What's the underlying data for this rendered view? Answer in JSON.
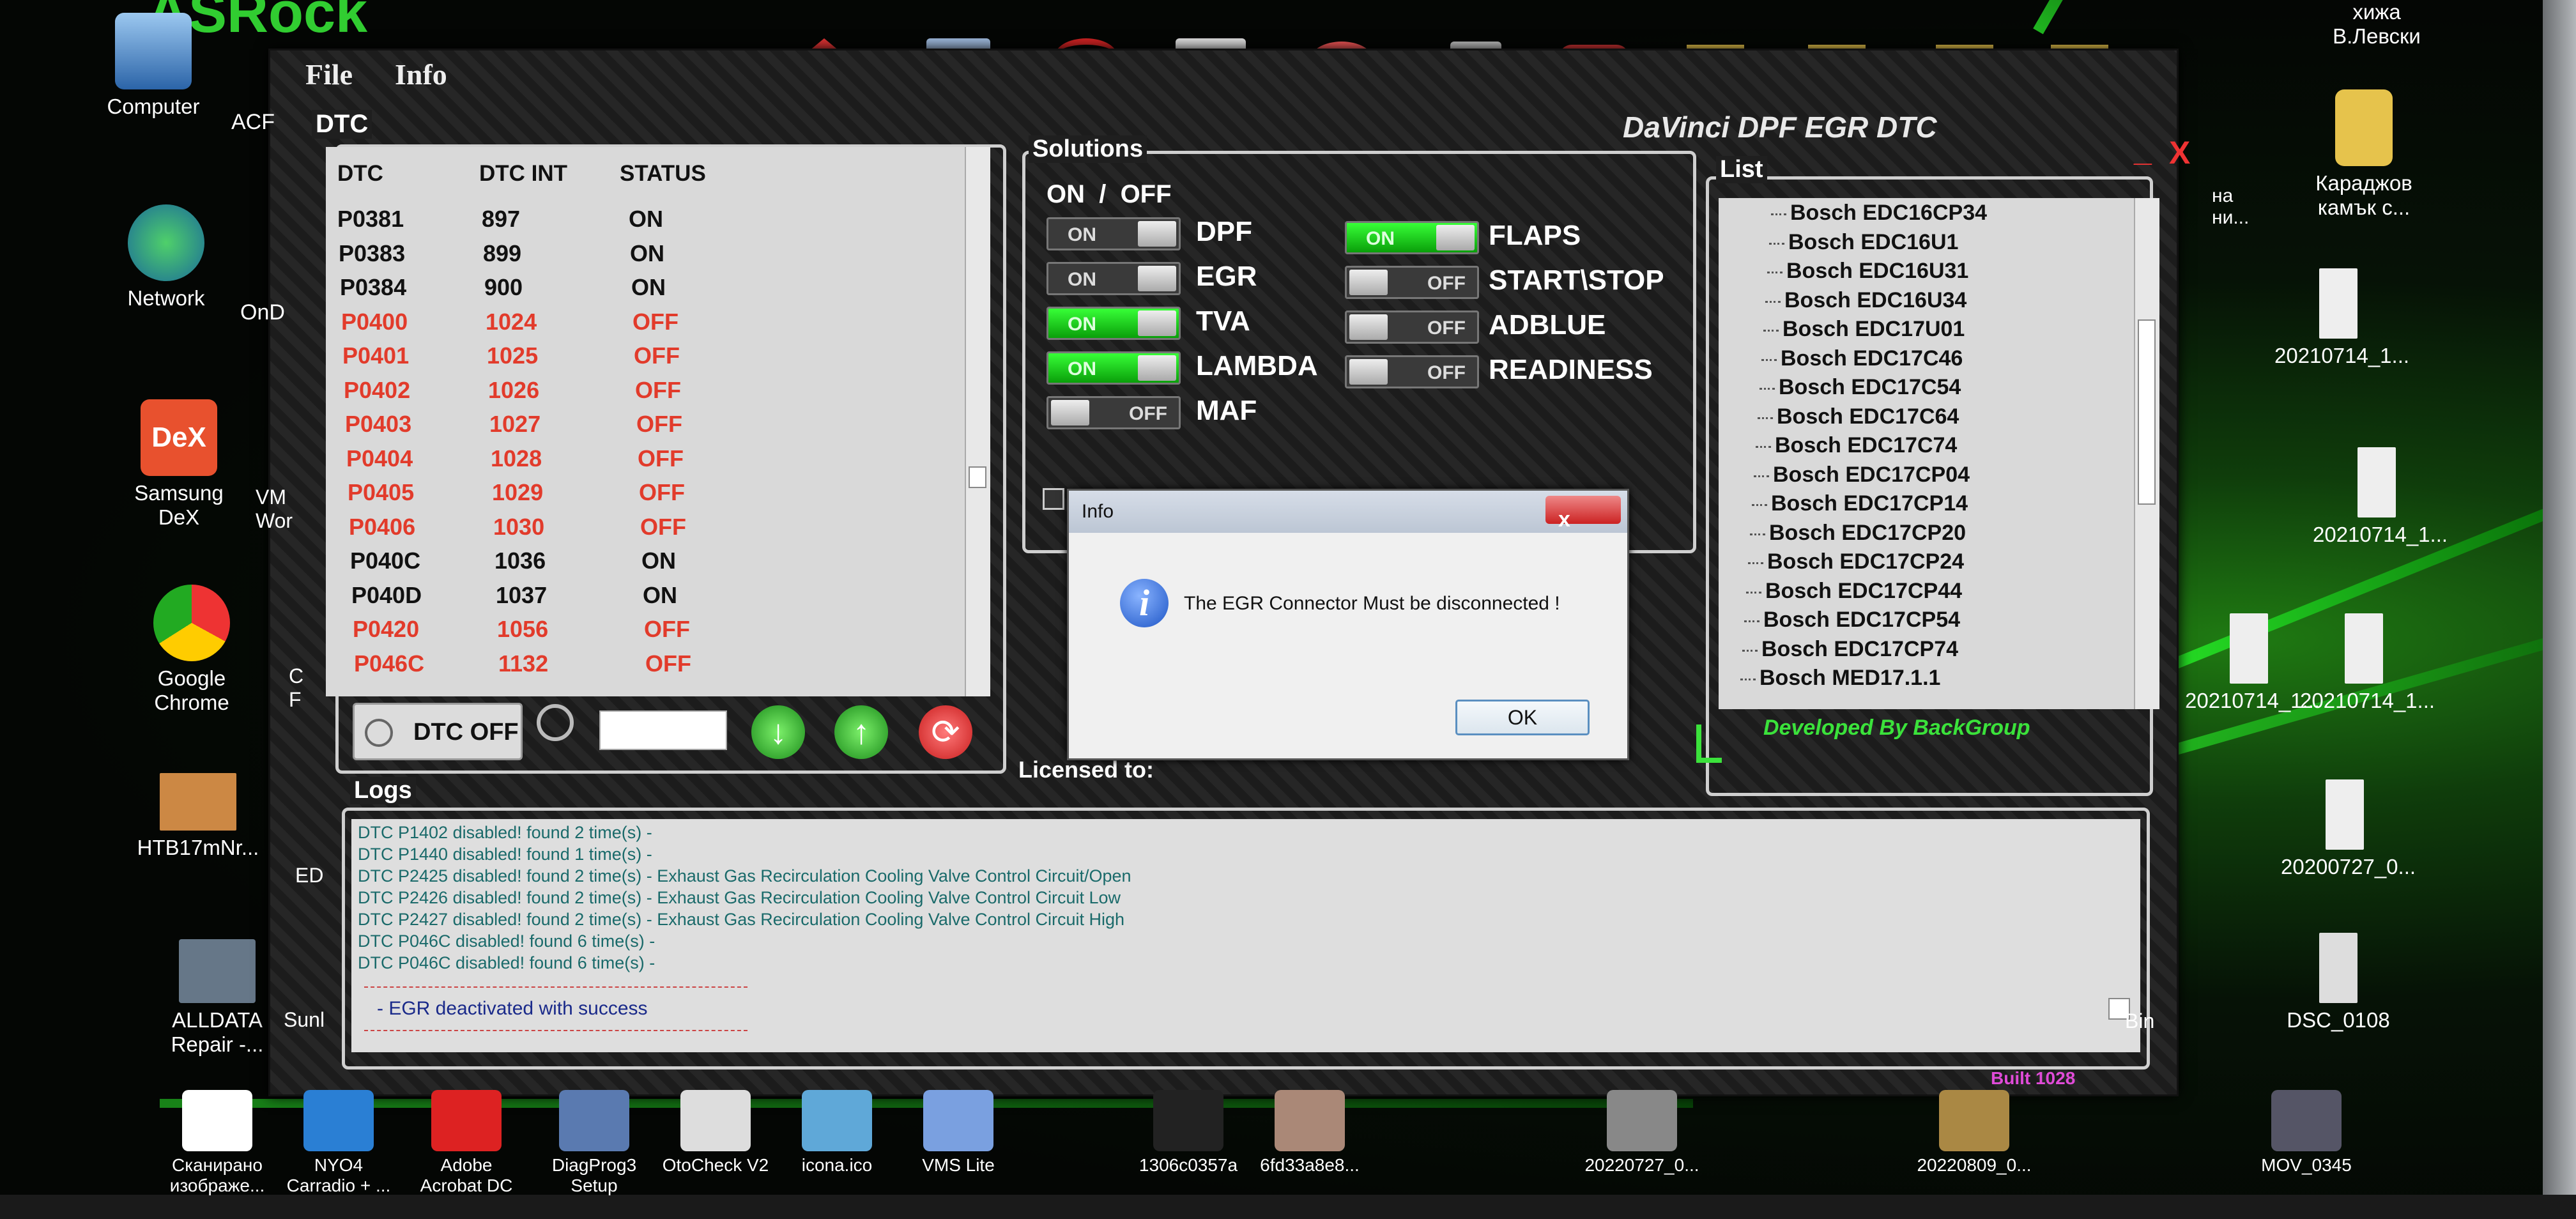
{
  "desktop_left": [
    {
      "label": "Computer",
      "icon": "computer-icon"
    },
    {
      "label": "Network",
      "icon": "network-icon"
    },
    {
      "label": "Samsung DeX",
      "icon": "dex-icon"
    },
    {
      "label": "Google Chrome",
      "icon": "chrome-icon"
    },
    {
      "label": "HTB17mNr...",
      "icon": "image-file-icon"
    },
    {
      "label": "ALLDATA Repair -...",
      "icon": "alldata-icon"
    }
  ],
  "desktop_left_partial": [
    "ACF",
    "OnD",
    "VM Wor",
    "C F",
    "ED",
    "Sunl"
  ],
  "desktop_right": [
    {
      "label": "хижа В.Левски"
    },
    {
      "label": "Караджов камък с..."
    },
    {
      "label": "20210714_1..."
    },
    {
      "label": "20210714_1..."
    },
    {
      "label": "20210714_1..."
    },
    {
      "label": "20210714_1..."
    },
    {
      "label": "20200727_0..."
    },
    {
      "label": "DSC_0108"
    }
  ],
  "desktop_right_partial": [
    "на ни...",
    "Bin"
  ],
  "taskbar": [
    {
      "label": "Сканирано изображе...",
      "icon": "pdf-icon"
    },
    {
      "label": "NYO4 Carradio + ...",
      "icon": "n4-icon"
    },
    {
      "label": "Adobe Acrobat DC",
      "icon": "acrobat-icon"
    },
    {
      "label": "DiagProg3 Setup",
      "icon": "installer-icon"
    },
    {
      "label": "OtoCheck V2",
      "icon": "otocheck-icon"
    },
    {
      "label": "icona.ico",
      "icon": "ico-file-icon"
    },
    {
      "label": "VMS Lite",
      "icon": "vms-icon"
    },
    {
      "label": "1306c0357a",
      "icon": "chip-image-icon"
    },
    {
      "label": "6fd33a8e8...",
      "icon": "photo-icon"
    },
    {
      "label": "20220727_0...",
      "icon": "photo-icon"
    },
    {
      "label": "20220809_0...",
      "icon": "photo-icon"
    },
    {
      "label": "MOV_0345",
      "icon": "video-icon"
    }
  ],
  "app": {
    "menu": {
      "file": "File",
      "info": "Info"
    },
    "title": "DaVinci DPF EGR DTC",
    "dtc": {
      "legend": "DTC",
      "headers": [
        "DTC",
        "DTC INT",
        "STATUS"
      ],
      "rows": [
        {
          "code": "P0381",
          "int": "897",
          "status": "ON"
        },
        {
          "code": "P0383",
          "int": "899",
          "status": "ON"
        },
        {
          "code": "P0384",
          "int": "900",
          "status": "ON"
        },
        {
          "code": "P0400",
          "int": "1024",
          "status": "OFF"
        },
        {
          "code": "P0401",
          "int": "1025",
          "status": "OFF"
        },
        {
          "code": "P0402",
          "int": "1026",
          "status": "OFF"
        },
        {
          "code": "P0403",
          "int": "1027",
          "status": "OFF"
        },
        {
          "code": "P0404",
          "int": "1028",
          "status": "OFF"
        },
        {
          "code": "P0405",
          "int": "1029",
          "status": "OFF"
        },
        {
          "code": "P0406",
          "int": "1030",
          "status": "OFF"
        },
        {
          "code": "P040C",
          "int": "1036",
          "status": "ON"
        },
        {
          "code": "P040D",
          "int": "1037",
          "status": "ON"
        },
        {
          "code": "P0420",
          "int": "1056",
          "status": "OFF"
        },
        {
          "code": "P046C",
          "int": "1132",
          "status": "OFF"
        }
      ],
      "dtc_off_button": "DTC OFF",
      "search_value": ""
    },
    "solutions": {
      "legend": "Solutions",
      "on_off_header": "ON  /  OFF",
      "left": [
        {
          "name": "DPF",
          "state": "ON"
        },
        {
          "name": "EGR",
          "state": "ON"
        },
        {
          "name": "TVA",
          "state": "ON"
        },
        {
          "name": "LAMBDA",
          "state": "ON"
        },
        {
          "name": "MAF",
          "state": "OFF"
        }
      ],
      "right": [
        {
          "name": "FLAPS",
          "state": "ON"
        },
        {
          "name": "START\\STOP",
          "state": "OFF"
        },
        {
          "name": "ADBLUE",
          "state": "OFF"
        },
        {
          "name": "READINESS",
          "state": "OFF"
        }
      ],
      "licensed_to": "Licensed to:"
    },
    "list": {
      "legend": "List",
      "items": [
        "Bosch EDC16CP34",
        "Bosch EDC16U1",
        "Bosch EDC16U31",
        "Bosch EDC16U34",
        "Bosch EDC17U01",
        "Bosch EDC17C46",
        "Bosch EDC17C54",
        "Bosch EDC17C64",
        "Bosch EDC17C74",
        "Bosch EDC17CP04",
        "Bosch EDC17CP14",
        "Bosch EDC17CP20",
        "Bosch EDC17CP24",
        "Bosch EDC17CP44",
        "Bosch EDC17CP54",
        "Bosch EDC17CP74",
        "Bosch MED17.1.1"
      ],
      "developed_by": "Developed By BackGroup"
    },
    "logs": {
      "legend": "Logs",
      "lines": [
        "DTC P1402 disabled! found 2 time(s) -",
        "DTC P1440 disabled! found 1 time(s) -",
        "DTC P2425 disabled! found 2 time(s) - Exhaust Gas Recirculation Cooling Valve Control Circuit/Open",
        "DTC P2426 disabled! found 2 time(s) - Exhaust Gas Recirculation Cooling Valve Control Circuit Low",
        "DTC P2427 disabled! found 2 time(s) - Exhaust Gas Recirculation Cooling Valve Control Circuit High",
        "DTC P046C disabled! found 6 time(s) -",
        "DTC P046C disabled! found 6 time(s) -"
      ],
      "success": "-   EGR deactivated with success"
    },
    "build": "Built 1028",
    "window_min": "_",
    "window_close": "X"
  },
  "dialog": {
    "title": "Info",
    "message": "The EGR Connector Must be disconnected !",
    "ok": "OK",
    "close": "x"
  },
  "colors": {
    "on_toggle": "#22d322",
    "off_text": "#e23b2b",
    "developed": "#3be23b",
    "build": "#e04bd8"
  }
}
